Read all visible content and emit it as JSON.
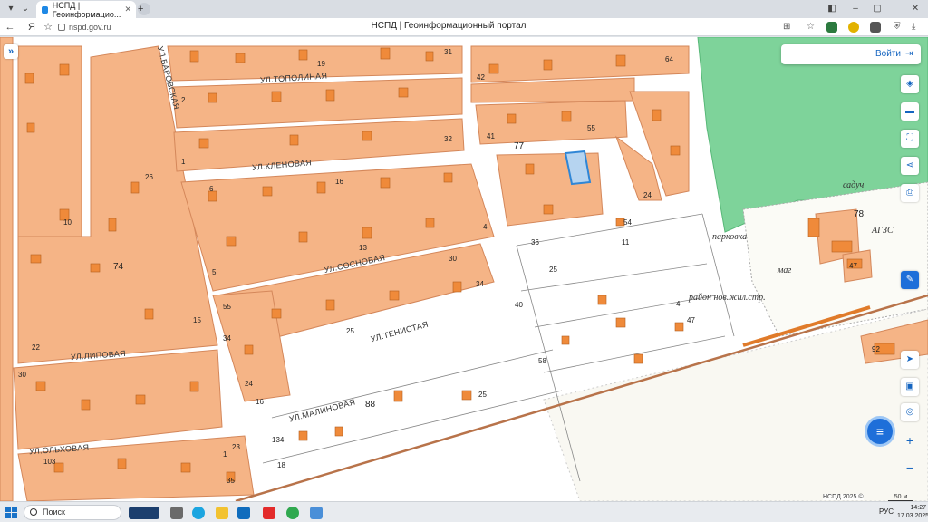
{
  "browser": {
    "tab_title": "НСПД | Геоинформацио...",
    "tab_close": "✕",
    "new_tab": "+",
    "url": "nspd.gov.ru",
    "page_title": "НСПД | Геоинформационный портал"
  },
  "map": {
    "login_label": "Войти",
    "expand_icon": "»",
    "streets": [
      "УЛ.ТОПОЛИНАЯ",
      "УЛ.КЛЕНОВАЯ",
      "УЛ.СОСНОВАЯ",
      "УЛ.ТЕНИСТАЯ",
      "УЛ.МАЛИНОВАЯ",
      "УЛ.ЛИПОВАЯ",
      "УЛ.ОЛЬХОВАЯ",
      "УЛ.ВАРОВСКАЯ"
    ],
    "quarters": [
      "74",
      "77",
      "78",
      "88"
    ],
    "house_numbers": [
      "19",
      "31",
      "42",
      "64",
      "2",
      "55",
      "41",
      "32",
      "1",
      "16",
      "24",
      "36",
      "6",
      "54",
      "11",
      "25",
      "30",
      "34",
      "13",
      "4",
      "25",
      "55",
      "40",
      "47",
      "58",
      "16",
      "24",
      "25",
      "134",
      "18",
      "30",
      "22",
      "15",
      "47",
      "92",
      "103",
      "35",
      "26",
      "23",
      "5",
      "34",
      "4",
      "10",
      "1"
    ],
    "annotations": [
      "парковка",
      "маг",
      "АГЗС",
      "садуч",
      "район нов.жил.стр."
    ],
    "attribution": "НСПД 2025 ©",
    "scale": "50 м",
    "colors": {
      "parcel": "#f5b486",
      "parcel_border": "#d4875a",
      "building": "#ef8a3a",
      "forest": "#7ed39a",
      "road": "#b8734a",
      "selection": "#2f86d6"
    }
  },
  "taskbar": {
    "search_placeholder": "Поиск",
    "lang": "РУС",
    "time": "14:27",
    "date": "17.03.2025"
  }
}
